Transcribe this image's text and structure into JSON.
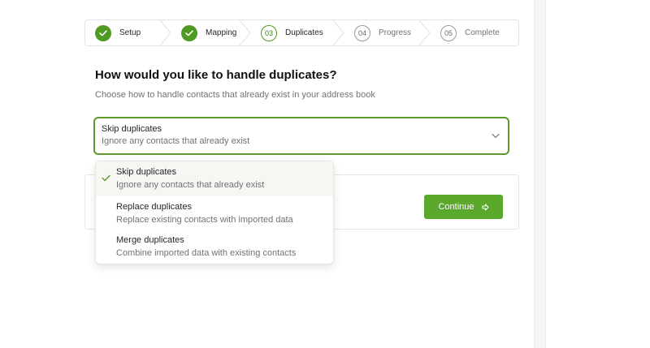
{
  "stepper": {
    "steps": [
      {
        "label": "Setup",
        "number": "",
        "state": "done"
      },
      {
        "label": "Mapping",
        "number": "",
        "state": "done"
      },
      {
        "label": "Duplicates",
        "number": "03",
        "state": "current"
      },
      {
        "label": "Progress",
        "number": "04",
        "state": "todo"
      },
      {
        "label": "Complete",
        "number": "05",
        "state": "todo"
      }
    ]
  },
  "main": {
    "title": "How would you like to handle duplicates?",
    "subtitle": "Choose how to handle contacts that already exist in your address book"
  },
  "select": {
    "title": "Skip duplicates",
    "description": "Ignore any contacts that already exist"
  },
  "dropdown": {
    "options": [
      {
        "title": "Skip duplicates",
        "description": "Ignore any contacts that already exist",
        "selected": true
      },
      {
        "title": "Replace duplicates",
        "description": "Replace existing contacts with imported data",
        "selected": false
      },
      {
        "title": "Merge duplicates",
        "description": "Combine imported data with existing contacts",
        "selected": false
      }
    ]
  },
  "actions": {
    "continue_label": "Continue",
    "continue_icon": "arrow-right-icon"
  },
  "colors": {
    "accent": "#5aa82c",
    "accent_dark": "#4f9a23"
  }
}
